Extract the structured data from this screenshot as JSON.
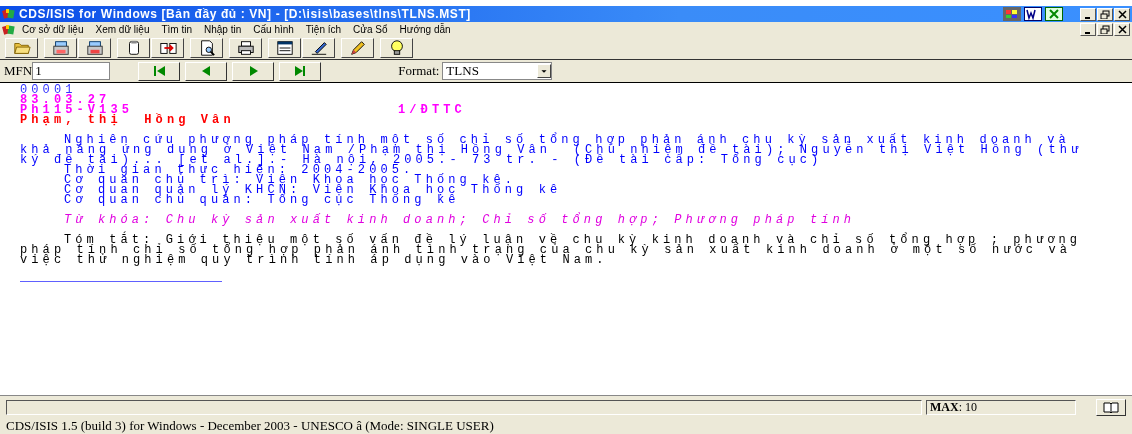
{
  "window": {
    "title": "CDS/ISIS for Windows [Bản đầy đủ : VN] - [D:\\isis\\bases\\tlns\\TLNS.MST]"
  },
  "menu": [
    "Cơ sở dữ liệu",
    "Xem dữ liệu",
    "Tìm tin",
    "Nhập tin",
    "Cấu hình",
    "Tiện ích",
    "Cửa Sổ",
    "Hướng dẫn"
  ],
  "navigation": {
    "mfn_label": "MFN",
    "mfn_value": "1",
    "format_label": "Format:",
    "format_value": "TLNS"
  },
  "record": [
    {
      "kind": "mfn",
      "paragraphs": [
        [
          "00001"
        ]
      ]
    },
    {
      "kind": "date",
      "paragraphs": [
        [
          "83.03.27"
        ]
      ]
    },
    {
      "kind": "call",
      "paragraphs": [
        [
          "Ph115-V135"
        ]
      ],
      "code": "1/ĐTTC"
    },
    {
      "kind": "author",
      "paragraphs": [
        [
          "Phạm, thị  Hồng Vân"
        ]
      ]
    },
    {
      "kind": "title",
      "paragraphs": [
        [
          "Nghiên cứu phương pháp tính một số chỉ số tổng hợp phản ánh chu kỳ sản xuất kinh doanh và",
          "khả năng ứng dụng ở Việt Nam /Phạm thị Hồng Vân  (Chủ nhiệm đề tài); Nguyễn thị Việt Hồng (thư",
          "ký đề tài)... [et al.].- Hà nội, 2005.- 73 tr. - (Đề tài cấp: Tổng cục)"
        ],
        [
          "Thời gian thực hiện: 2004-2005."
        ],
        [
          "Cơ quan chủ trì: Viện Khoa học Thống kê."
        ],
        [
          "Cơ quan quản lý KHCN: Viện Khoa học Thống kê"
        ],
        [
          "Cơ quan chủ quản: Tổng cục Thống kê"
        ]
      ]
    },
    {
      "kind": "keyword",
      "paragraphs": [
        [
          "Từ khóa: Chu kỳ sản xuất kinh doanh; Chỉ số tổng hợp; Phương pháp tính"
        ]
      ]
    },
    {
      "kind": "abstract",
      "paragraphs": [
        [
          "Tóm tắt: Giới thiệu một số vấn đề lý luận về chu kỳ kinh doanh và chỉ số tổng hợp ; phương",
          "pháp tính chỉ số tổng hợp phản ánh tình trạng của chu kỳ sản xuất kinh doanh ở một số nước và",
          "việc thử nghiệm quy trình tính áp dụng vào Việt Nam."
        ]
      ]
    }
  ],
  "status_bar": {
    "max_label": "MAX",
    "max_value": ": 10"
  },
  "footer": "CDS/ISIS 1.5 (build 3) for Windows - December 2003 - UNESCO â (Mode: SINGLE USER)"
}
